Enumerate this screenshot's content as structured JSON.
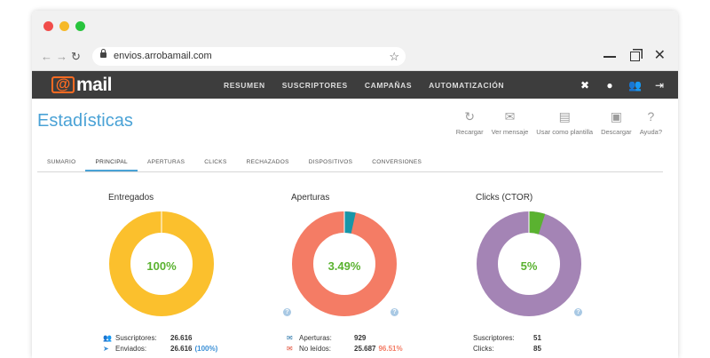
{
  "browser": {
    "url": "envios.arrobamail.com"
  },
  "app": {
    "logo_at": "@",
    "logo_word": "mail",
    "nav": [
      "RESUMEN",
      "SUSCRIPTORES",
      "CAMPAÑAS",
      "AUTOMATIZACIÓN"
    ]
  },
  "page": {
    "title": "Estadísticas",
    "actions": [
      {
        "label": "Recargar",
        "icon": "reload-icon"
      },
      {
        "label": "Ver mensaje",
        "icon": "envelope-icon"
      },
      {
        "label": "Usar como plantilla",
        "icon": "document-icon"
      },
      {
        "label": "Descargar",
        "icon": "pdf-icon"
      },
      {
        "label": "Ayuda?",
        "icon": "help-icon"
      }
    ],
    "tabs": [
      "SUMARIO",
      "PRINCIPAL",
      "APERTURAS",
      "CLICKS",
      "RECHAZADOS",
      "DISPOSITIVOS",
      "CONVERSIONES"
    ],
    "active_tab": "PRINCIPAL"
  },
  "cards": [
    {
      "title": "Entregados",
      "center_text": "100%",
      "percent": 100,
      "fill_color": "#fbc02d",
      "rest_color": "#fbc02d",
      "stats": [
        {
          "label": "Suscriptores:",
          "value": "26.616",
          "extra": "",
          "extra_color": "",
          "icon": "users-icon",
          "icon_color": "#3aa657"
        },
        {
          "label": "Enviados:",
          "value": "26.616",
          "extra": "(100%)",
          "extra_color": "#3a8fd6",
          "icon": "paper-plane-icon",
          "icon_color": "#3a8fd6"
        }
      ]
    },
    {
      "title": "Aperturas",
      "center_text": "3.49%",
      "percent": 3.49,
      "fill_color": "#1796a8",
      "rest_color": "#f47c65",
      "stats": [
        {
          "label": "Aperturas:",
          "value": "929",
          "extra": "",
          "extra_color": "",
          "icon": "open-envelope-icon",
          "icon_color": "#1f6fa5"
        },
        {
          "label": "No leídos:",
          "value": "25.687",
          "extra": "96.51%",
          "extra_color": "#f47c65",
          "icon": "unread-envelope-icon",
          "icon_color": "#e0462e"
        }
      ]
    },
    {
      "title": "Clicks (CTOR)",
      "center_text": "5%",
      "percent": 5,
      "fill_color": "#5ab230",
      "rest_color": "#a484b5",
      "stats": [
        {
          "label": "Suscriptores:",
          "value": "51",
          "extra": "",
          "extra_color": "",
          "icon": "",
          "icon_color": ""
        },
        {
          "label": "Clicks:",
          "value": "85",
          "extra": "",
          "extra_color": "",
          "icon": "",
          "icon_color": ""
        }
      ]
    }
  ]
}
